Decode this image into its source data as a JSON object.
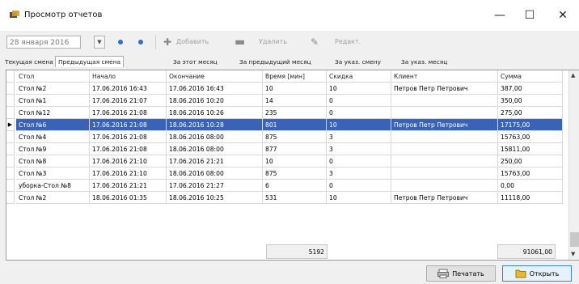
{
  "window": {
    "title": "Просмотр отчетов",
    "controls": {
      "minimize": "—",
      "maximize": "☐",
      "close": "✕"
    }
  },
  "toolbar": {
    "date": "28 января 2016",
    "add_label": "Добавить",
    "delete_label": "Удалить",
    "edit_label": "Редакт."
  },
  "tabs": [
    {
      "label": "Текущая смена"
    },
    {
      "label": "Предыдущая смена"
    },
    {
      "label": "За этот месяц"
    },
    {
      "label": "За предыдущий месяц"
    },
    {
      "label": "За указ. смену"
    },
    {
      "label": "За указ. месяц"
    }
  ],
  "table": {
    "columns": [
      "Стол",
      "Начало",
      "Окончание",
      "Время [мин]",
      "Скидка",
      "Клиент",
      "Сумма"
    ],
    "rows": [
      [
        "Стол №2",
        "17.06.2016 16:43",
        "17.06.2016 16:43",
        "10",
        "10",
        "Петров Петр Петрович",
        "387,00"
      ],
      [
        "Стол №1",
        "17.06.2016 21:07",
        "18.06.2016 10:20",
        "14",
        "0",
        "",
        "350,00"
      ],
      [
        "Стол №12",
        "17.06.2016 21:08",
        "18.06.2016 10:26",
        "235",
        "0",
        "",
        "275,00"
      ],
      [
        "Стол №6",
        "17.06.2016 21:08",
        "18.06.2016 10:28",
        "801",
        "10",
        "Петров Петр Петрович",
        "17175,00"
      ],
      [
        "Стол №4",
        "17.06.2016 21:08",
        "18.06.2016 08:00",
        "875",
        "3",
        "",
        "15763,00"
      ],
      [
        "Стол №9",
        "17.06.2016 21:08",
        "18.06.2016 08:00",
        "877",
        "3",
        "",
        "15811,00"
      ],
      [
        "Стол №8",
        "17.06.2016 21:10",
        "17.06.2016 21:21",
        "10",
        "0",
        "",
        "250,00"
      ],
      [
        "Стол №3",
        "17.06.2016 21:10",
        "18.06.2016 08:00",
        "875",
        "3",
        "",
        "15763,00"
      ],
      [
        "уборка-Стол №8",
        "17.06.2016 21:21",
        "17.06.2016 21:27",
        "6",
        "0",
        "",
        "0,00"
      ],
      [
        "Стол №2",
        "18.06.2016 01:35",
        "18.06.2016 10:25",
        "531",
        "10",
        "Петров Петр Петрович",
        "11118,00"
      ]
    ],
    "selected_row": 3,
    "totals": {
      "time": "5192",
      "sum": "91061,00"
    }
  },
  "buttons": {
    "print_label": "Печатать",
    "open_label": "Открыть"
  }
}
